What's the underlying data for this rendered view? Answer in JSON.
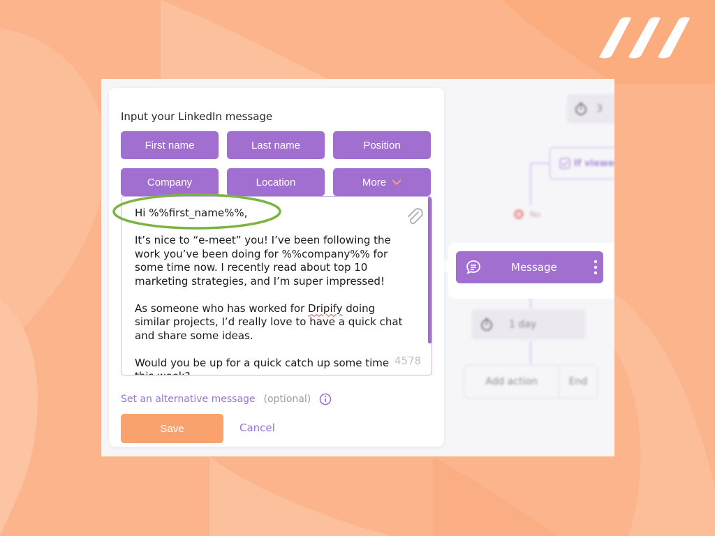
{
  "brand": {
    "logo_icon": "slanted-stripes-logo"
  },
  "colors": {
    "accent_purple": "#a06fd0",
    "save_orange": "#f9a26d",
    "background_orange": "#fbb48c",
    "highlight_green": "#7ab441"
  },
  "dialog": {
    "title": "Input your LinkedIn message",
    "variables": [
      {
        "label": "First name"
      },
      {
        "label": "Last name"
      },
      {
        "label": "Position"
      },
      {
        "label": "Company"
      },
      {
        "label": "Location"
      },
      {
        "label": "More"
      }
    ],
    "message": {
      "greeting": "Hi %%first_name%%,",
      "paragraph1": "It’s nice to “e-meet” you! I’ve been following the work you’ve been doing for %%company%% for some time now. I recently read about top 10 marketing strategies, and I’m super impressed!",
      "paragraph2_before": "As someone who has worked for ",
      "paragraph2_brand": "Dripify",
      "paragraph2_after": " doing similar projects, I’d really love to have a quick chat and share some ideas.",
      "paragraph3": "Would you be up for a quick catch up some time this week?",
      "char_counter": "4578"
    },
    "alternative_link": "Set an alternative message",
    "alternative_optional": "(optional)",
    "save_label": "Save",
    "cancel_label": "Cancel"
  },
  "flow": {
    "top_timer_value": "3",
    "if_viewed_label": "If viewed",
    "no_label": "No",
    "message_node_label": "Message",
    "delay_label": "1 day",
    "add_action_label": "Add action",
    "end_label": "End"
  }
}
